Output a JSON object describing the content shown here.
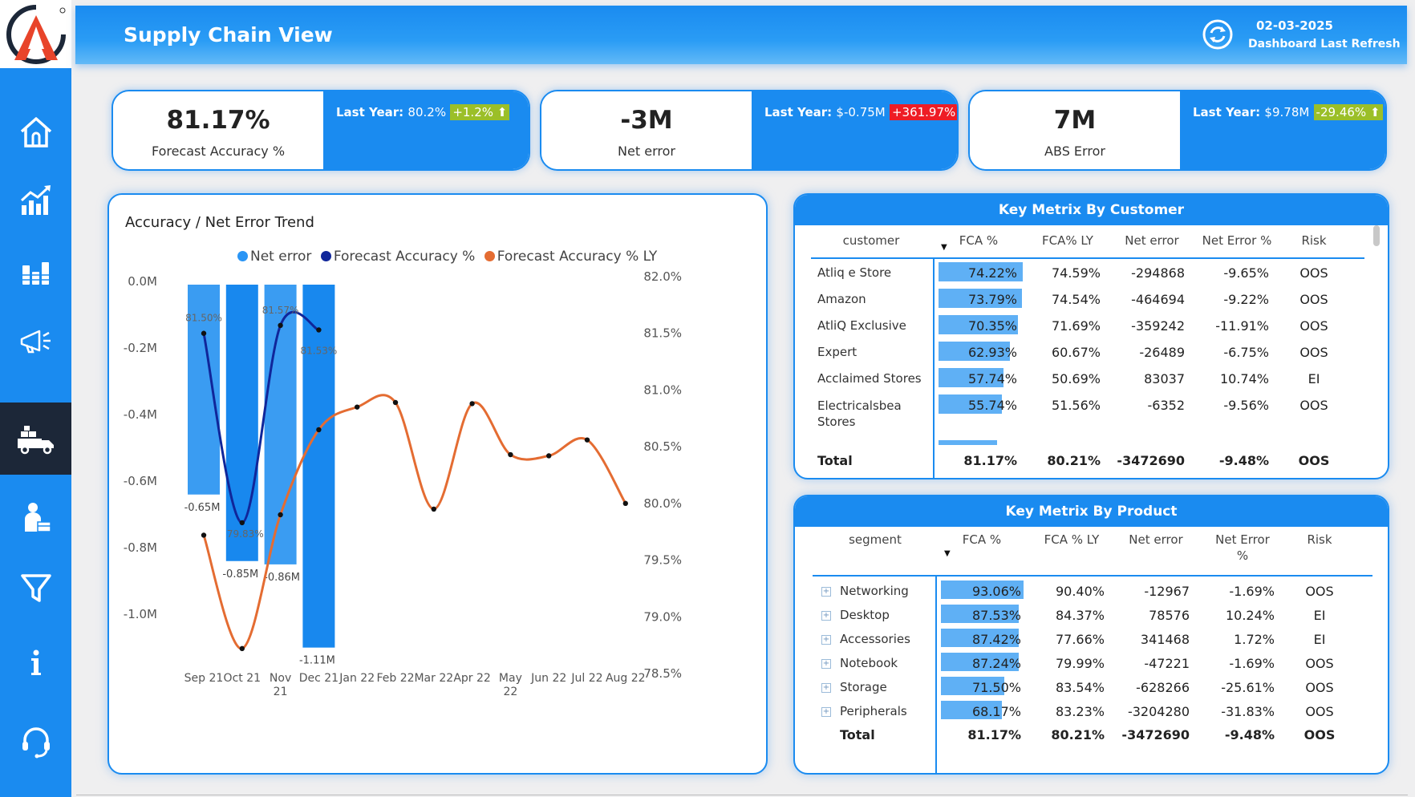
{
  "header": {
    "title": "Supply Chain View",
    "refresh_date": "02-03-2025",
    "refresh_label": "Dashboard Last Refresh"
  },
  "sidebar": {
    "items": [
      {
        "icon": "home-icon"
      },
      {
        "icon": "growth-chart-icon"
      },
      {
        "icon": "bar-chart-icon"
      },
      {
        "icon": "megaphone-icon"
      },
      {
        "icon": "delivery-truck-icon",
        "active": true
      },
      {
        "icon": "employee-icon"
      },
      {
        "icon": "filter-icon"
      },
      {
        "icon": "info-icon"
      },
      {
        "icon": "support-headset-icon"
      }
    ]
  },
  "kpis": [
    {
      "value": "81.17%",
      "label": "Forecast Accuracy %",
      "ly_label": "Last Year:",
      "ly_value": "80.2%",
      "change": "+1.2%",
      "direction": "up"
    },
    {
      "value": "-3M",
      "label": "Net error",
      "ly_label": "Last Year:",
      "ly_value": "$-0.75M",
      "change": "+361.97%",
      "direction": "down"
    },
    {
      "value": "7M",
      "label": "ABS Error",
      "ly_label": "Last Year:",
      "ly_value": "$9.78M",
      "change": "-29.46%",
      "direction": "up"
    }
  ],
  "colors": {
    "brand": "#1a8bf0",
    "net_error": "#2a95f5",
    "forecast_accuracy": "#10269a",
    "forecast_accuracy_ly": "#e46c32",
    "change_good": "#9bbf28",
    "change_bad": "#ee1c25",
    "sidebar_active": "#1c2738"
  },
  "trend": {
    "title": "Accuracy / Net Error Trend",
    "legend": [
      "Net error",
      "Forecast Accuracy %",
      "Forecast Accuracy % LY"
    ]
  },
  "chart_data": {
    "type": "bar",
    "title": "Accuracy / Net Error Trend",
    "categories": [
      "Sep 21",
      "Oct 21",
      "Nov 21",
      "Dec 21",
      "Jan 22",
      "Feb 22",
      "Mar 22",
      "Apr 22",
      "May 22",
      "Jun 22",
      "Jul 22",
      "Aug 22"
    ],
    "y_left": {
      "ticks": [
        "0.0M",
        "-0.2M",
        "-0.4M",
        "-0.6M",
        "-0.8M",
        "-1.0M"
      ],
      "range": [
        -1.2,
        0.0
      ]
    },
    "y_right": {
      "ticks": [
        "82.0%",
        "81.5%",
        "81.0%",
        "80.5%",
        "80.0%",
        "79.5%",
        "79.0%",
        "78.5%"
      ],
      "range": [
        78.5,
        82.0
      ]
    },
    "series": [
      {
        "name": "Net error",
        "type": "bar",
        "axis": "left",
        "values": [
          -0.65,
          -0.85,
          -0.86,
          -1.11,
          null,
          null,
          null,
          null,
          null,
          null,
          null,
          null
        ],
        "labels": [
          "-0.65M",
          "-0.85M",
          "-0.86M",
          "-1.11M"
        ]
      },
      {
        "name": "Forecast Accuracy %",
        "type": "line",
        "axis": "right",
        "values": [
          81.5,
          79.83,
          81.57,
          81.53,
          null,
          null,
          null,
          null,
          null,
          null,
          null,
          null
        ],
        "labels": [
          "81.50%",
          "79.83%",
          "81.57%",
          "81.53%"
        ]
      },
      {
        "name": "Forecast Accuracy % LY",
        "type": "line",
        "axis": "right",
        "values": [
          79.72,
          78.72,
          79.9,
          80.65,
          80.85,
          80.89,
          79.95,
          80.88,
          80.43,
          80.42,
          80.56,
          80.0
        ]
      }
    ]
  },
  "customer_table": {
    "title": "Key Metrix By Customer",
    "columns": [
      "customer",
      "FCA %",
      "FCA% LY",
      "Net error",
      "Net Error %",
      "Risk"
    ],
    "rows": [
      {
        "name": "Atliq e Store",
        "fca": "74.22%",
        "fca_value": 74.22,
        "fca_ly": "74.59%",
        "net_error": "-294868",
        "net_error_pct": "-9.65%",
        "risk": "OOS"
      },
      {
        "name": "Amazon",
        "fca": "73.79%",
        "fca_value": 73.79,
        "fca_ly": "74.54%",
        "net_error": "-464694",
        "net_error_pct": "-9.22%",
        "risk": "OOS"
      },
      {
        "name": "AtliQ Exclusive",
        "fca": "70.35%",
        "fca_value": 70.35,
        "fca_ly": "71.69%",
        "net_error": "-359242",
        "net_error_pct": "-11.91%",
        "risk": "OOS"
      },
      {
        "name": "Expert",
        "fca": "62.93%",
        "fca_value": 62.93,
        "fca_ly": "60.67%",
        "net_error": "-26489",
        "net_error_pct": "-6.75%",
        "risk": "OOS"
      },
      {
        "name": "Acclaimed Stores",
        "fca": "57.74%",
        "fca_value": 57.74,
        "fca_ly": "50.69%",
        "net_error": "83037",
        "net_error_pct": "10.74%",
        "risk": "EI"
      },
      {
        "name": "Electricalsbea Stores",
        "fca": "55.74%",
        "fca_value": 55.74,
        "fca_ly": "51.56%",
        "net_error": "-6352",
        "net_error_pct": "-9.56%",
        "risk": "OOS"
      }
    ],
    "total": {
      "name": "Total",
      "fca": "81.17%",
      "fca_ly": "80.21%",
      "net_error": "-3472690",
      "net_error_pct": "-9.48%",
      "risk": "OOS"
    }
  },
  "product_table": {
    "title": "Key Metrix By Product",
    "columns": [
      "segment",
      "FCA %",
      "FCA % LY",
      "Net error",
      "Net Error %",
      "Risk"
    ],
    "rows": [
      {
        "name": "Networking",
        "fca": "93.06%",
        "fca_value": 93.06,
        "fca_ly": "90.40%",
        "net_error": "-12967",
        "net_error_pct": "-1.69%",
        "risk": "OOS"
      },
      {
        "name": "Desktop",
        "fca": "87.53%",
        "fca_value": 87.53,
        "fca_ly": "84.37%",
        "net_error": "78576",
        "net_error_pct": "10.24%",
        "risk": "EI"
      },
      {
        "name": "Accessories",
        "fca": "87.42%",
        "fca_value": 87.42,
        "fca_ly": "77.66%",
        "net_error": "341468",
        "net_error_pct": "1.72%",
        "risk": "EI"
      },
      {
        "name": "Notebook",
        "fca": "87.24%",
        "fca_value": 87.24,
        "fca_ly": "79.99%",
        "net_error": "-47221",
        "net_error_pct": "-1.69%",
        "risk": "OOS"
      },
      {
        "name": "Storage",
        "fca": "71.50%",
        "fca_value": 71.5,
        "fca_ly": "83.54%",
        "net_error": "-628266",
        "net_error_pct": "-25.61%",
        "risk": "OOS"
      },
      {
        "name": "Peripherals",
        "fca": "68.17%",
        "fca_value": 68.17,
        "fca_ly": "83.23%",
        "net_error": "-3204280",
        "net_error_pct": "-31.83%",
        "risk": "OOS"
      }
    ],
    "total": {
      "name": "Total",
      "fca": "81.17%",
      "fca_ly": "80.21%",
      "net_error": "-3472690",
      "net_error_pct": "-9.48%",
      "risk": "OOS"
    }
  }
}
